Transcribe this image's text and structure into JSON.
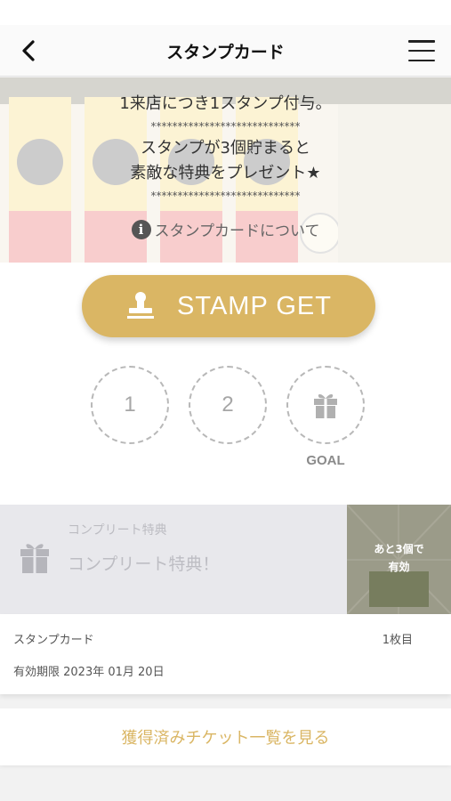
{
  "header": {
    "title": "スタンプカード",
    "back_icon": "chevron-left-icon",
    "menu_icon": "hamburger-menu-icon"
  },
  "hero": {
    "line1": "1来店につき1スタンプ付与。",
    "stars1": "****************************",
    "line2": "スタンプが3個貯まると",
    "line3": "素敵な特典をプレゼント★",
    "stars2": "****************************",
    "about_link": "スタンプカードについて",
    "about_icon": "info-icon"
  },
  "stamp": {
    "button_label": "STAMP GET",
    "button_icon": "stamp-icon",
    "accent_color": "#dab664",
    "slots": [
      "1",
      "2"
    ],
    "goal_icon": "gift-icon",
    "goal_label": "GOAL"
  },
  "complete": {
    "small_title": "コンプリート特典",
    "title": "コンプリート特典！",
    "icon": "gift-icon",
    "remaining_line1": "あと3個で",
    "remaining_line2": "有効"
  },
  "card": {
    "name": "スタンプカード",
    "count": "1枚目",
    "expiry": "有効期限 2023年 01月 20日"
  },
  "tickets_link": "獲得済みチケット一覧を見る"
}
